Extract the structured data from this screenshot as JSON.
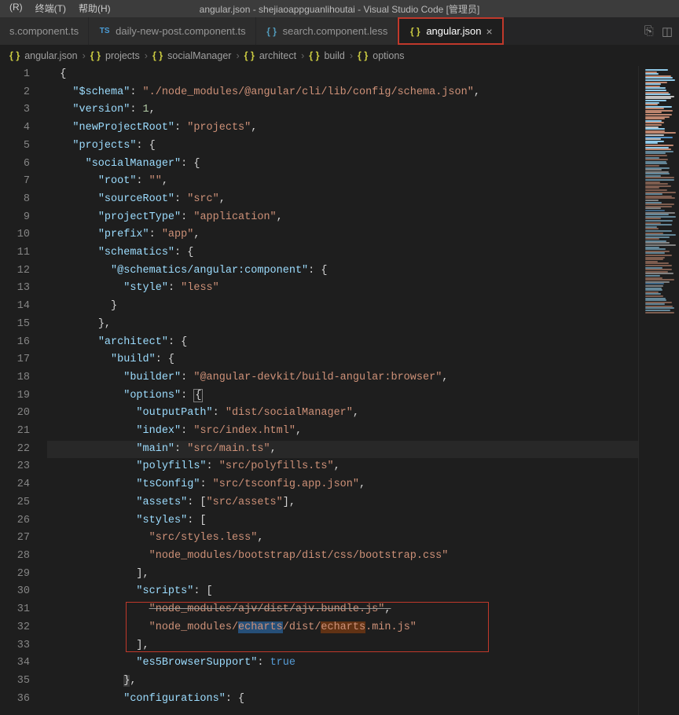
{
  "app": {
    "title": "angular.json - shejiaoappguanlihoutai - Visual Studio Code [管理员]"
  },
  "menu": {
    "m1": "(R)",
    "m2": "终端(T)",
    "m3": "帮助(H)"
  },
  "tabs": [
    {
      "name": "s.component.ts",
      "icon": "ts"
    },
    {
      "name": "daily-new-post.component.ts",
      "icon": "ts"
    },
    {
      "name": "search.component.less",
      "icon": "less"
    },
    {
      "name": "angular.json",
      "icon": "json",
      "active": true
    }
  ],
  "right_icons": {
    "git": "⎇",
    "split": "▥"
  },
  "breadcrumbs": [
    "angular.json",
    "projects",
    "socialManager",
    "architect",
    "build",
    "options"
  ],
  "code": {
    "l1": "{",
    "l2": {
      "k": "$schema",
      "v": "./node_modules/@angular/cli/lib/config/schema.json"
    },
    "l3": {
      "k": "version",
      "v": "1"
    },
    "l4": {
      "k": "newProjectRoot",
      "v": "projects"
    },
    "l5": {
      "k": "projects"
    },
    "l6": {
      "k": "socialManager"
    },
    "l7": {
      "k": "root",
      "v": ""
    },
    "l8": {
      "k": "sourceRoot",
      "v": "src"
    },
    "l9": {
      "k": "projectType",
      "v": "application"
    },
    "l10": {
      "k": "prefix",
      "v": "app"
    },
    "l11": {
      "k": "schematics"
    },
    "l12": {
      "k": "@schematics/angular:component"
    },
    "l13": {
      "k": "style",
      "v": "less"
    },
    "l16": {
      "k": "architect"
    },
    "l17": {
      "k": "build"
    },
    "l18": {
      "k": "builder",
      "v": "@angular-devkit/build-angular:browser"
    },
    "l19": {
      "k": "options"
    },
    "l20": {
      "k": "outputPath",
      "v": "dist/socialManager"
    },
    "l21": {
      "k": "index",
      "v": "src/index.html"
    },
    "l22": {
      "k": "main",
      "v": "src/main.ts"
    },
    "l23": {
      "k": "polyfills",
      "v": "src/polyfills.ts"
    },
    "l24": {
      "k": "tsConfig",
      "v": "src/tsconfig.app.json"
    },
    "l25": {
      "k": "assets",
      "v": "src/assets"
    },
    "l26": {
      "k": "styles"
    },
    "l27": {
      "v": "src/styles.less"
    },
    "l28": {
      "v": "node_modules/bootstrap/dist/css/bootstrap.css"
    },
    "l30": {
      "k": "scripts"
    },
    "l31": {
      "v": "node_modules/ajv/dist/ajv.bundle.js"
    },
    "l32": {
      "a": "node_modules/",
      "b": "echarts",
      "c": "/dist/",
      "d": "echarts",
      "e": ".min.js"
    },
    "l34": {
      "k": "es5BrowserSupport",
      "v": "true"
    },
    "l36": {
      "k": "configurations"
    }
  },
  "line_numbers": [
    "1",
    "2",
    "3",
    "4",
    "5",
    "6",
    "7",
    "8",
    "9",
    "10",
    "11",
    "12",
    "13",
    "14",
    "15",
    "16",
    "17",
    "18",
    "19",
    "20",
    "21",
    "22",
    "23",
    "24",
    "25",
    "26",
    "27",
    "28",
    "29",
    "30",
    "31",
    "32",
    "33",
    "34",
    "35",
    "36"
  ]
}
